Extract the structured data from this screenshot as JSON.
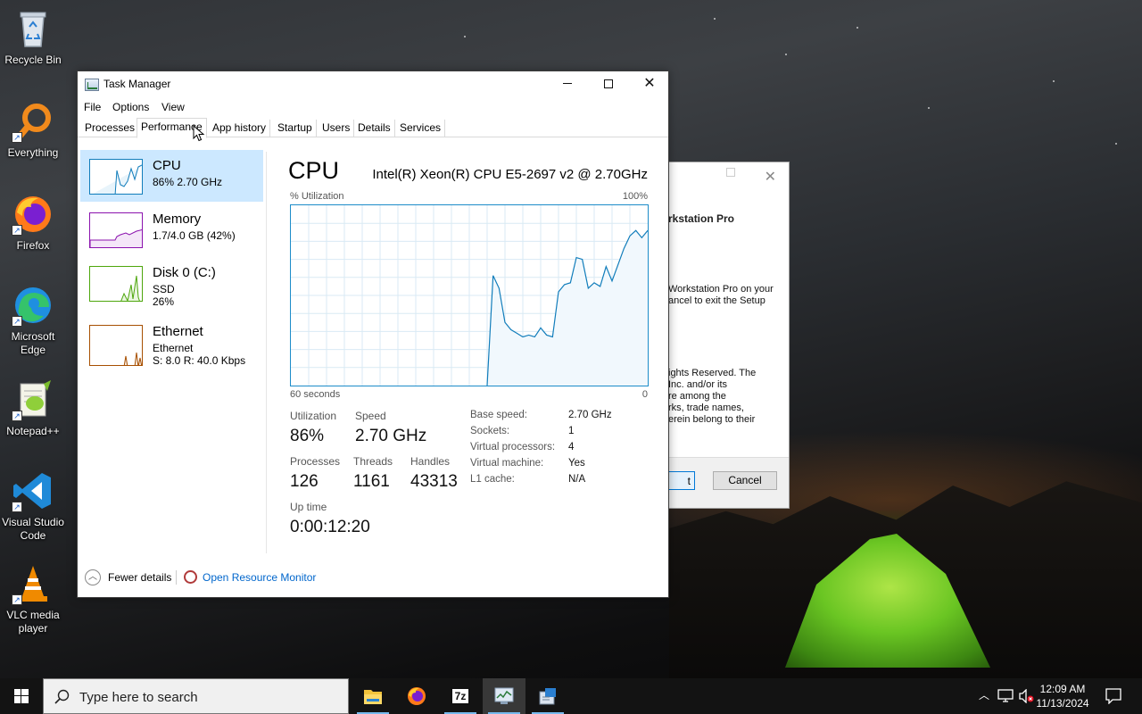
{
  "desktop": {
    "icons": [
      {
        "label": "Recycle Bin"
      },
      {
        "label": "Everything"
      },
      {
        "label": "Firefox"
      },
      {
        "label": "Microsoft Edge"
      },
      {
        "label": "Notepad++"
      },
      {
        "label": "Visual Studio Code"
      },
      {
        "label": "VLC media player"
      }
    ]
  },
  "setup_dialog": {
    "heading": "rkstation Pro",
    "line1": "Workstation Pro on your",
    "line2": "ancel to exit the Setup",
    "legal": [
      "ights Reserved. The",
      "Inc. and/or its",
      "re among the",
      "rks, trade names,",
      "erein belong to their"
    ],
    "next_label": "t",
    "cancel_label": "Cancel"
  },
  "taskmanager": {
    "title": "Task Manager",
    "menu": [
      "File",
      "Options",
      "View"
    ],
    "tabs": [
      "Processes",
      "Performance",
      "App history",
      "Startup",
      "Users",
      "Details",
      "Services"
    ],
    "active_tab": "Performance",
    "sidebar": [
      {
        "name": "CPU",
        "line1": "86% 2.70 GHz",
        "color": "#117dbb"
      },
      {
        "name": "Memory",
        "line1": "1.7/4.0 GB (42%)",
        "color": "#8b12ae"
      },
      {
        "name": "Disk 0 (C:)",
        "line1": "SSD",
        "line2": "26%",
        "color": "#4da60c"
      },
      {
        "name": "Ethernet",
        "line1": "Ethernet",
        "line2": "S: 8.0  R: 40.0 Kbps",
        "color": "#a74f01"
      }
    ],
    "main": {
      "title": "CPU",
      "processor": "Intel(R) Xeon(R) CPU E5-2697 v2 @ 2.70GHz",
      "y_label": "% Utilization",
      "y_max_label": "100%",
      "x_left_label": "60 seconds",
      "x_right_label": "0",
      "stats": {
        "utilization_label": "Utilization",
        "utilization": "86%",
        "speed_label": "Speed",
        "speed": "2.70 GHz",
        "processes_label": "Processes",
        "processes": "126",
        "threads_label": "Threads",
        "threads": "1161",
        "handles_label": "Handles",
        "handles": "43313",
        "uptime_label": "Up time",
        "uptime": "0:00:12:20"
      },
      "details": [
        {
          "label": "Base speed:",
          "value": "2.70 GHz"
        },
        {
          "label": "Sockets:",
          "value": "1"
        },
        {
          "label": "Virtual processors:",
          "value": "4"
        },
        {
          "label": "Virtual machine:",
          "value": "Yes"
        },
        {
          "label": "L1 cache:",
          "value": "N/A"
        }
      ]
    },
    "footer": {
      "fewer_details": "Fewer details",
      "open_resource_monitor": "Open Resource Monitor"
    }
  },
  "chart_data": {
    "type": "area",
    "ylim": [
      0,
      100
    ],
    "xlim": [
      60,
      0
    ],
    "xlabel": "60 seconds",
    "ylabel": "% Utilization",
    "x": [
      60,
      59,
      58,
      57,
      56,
      55,
      54,
      53,
      52,
      51,
      50,
      49,
      48,
      47,
      46,
      45,
      44,
      43,
      42,
      41,
      40,
      39,
      38,
      37,
      36,
      35,
      34,
      33,
      32,
      31,
      30,
      29,
      28,
      27,
      26,
      25,
      24,
      23,
      22,
      21,
      20,
      19,
      18,
      17,
      16,
      15,
      14,
      13,
      12,
      11,
      10,
      9,
      8,
      7,
      6,
      5,
      4,
      3,
      2,
      1,
      0
    ],
    "values": [
      0,
      0,
      0,
      0,
      0,
      0,
      0,
      0,
      0,
      0,
      0,
      0,
      0,
      0,
      0,
      0,
      0,
      0,
      0,
      0,
      0,
      0,
      0,
      0,
      0,
      0,
      0,
      0,
      0,
      0,
      0,
      61,
      54,
      35,
      31,
      29,
      27,
      28,
      27,
      32,
      28,
      27,
      52,
      56,
      57,
      71,
      70,
      54,
      57,
      55,
      66,
      58,
      67,
      76,
      83,
      86,
      82,
      86
    ],
    "series": [
      {
        "color": "#117dbb"
      }
    ]
  },
  "taskbar": {
    "search_placeholder": "Type here to search",
    "time": "12:09 AM",
    "date": "11/13/2024"
  }
}
